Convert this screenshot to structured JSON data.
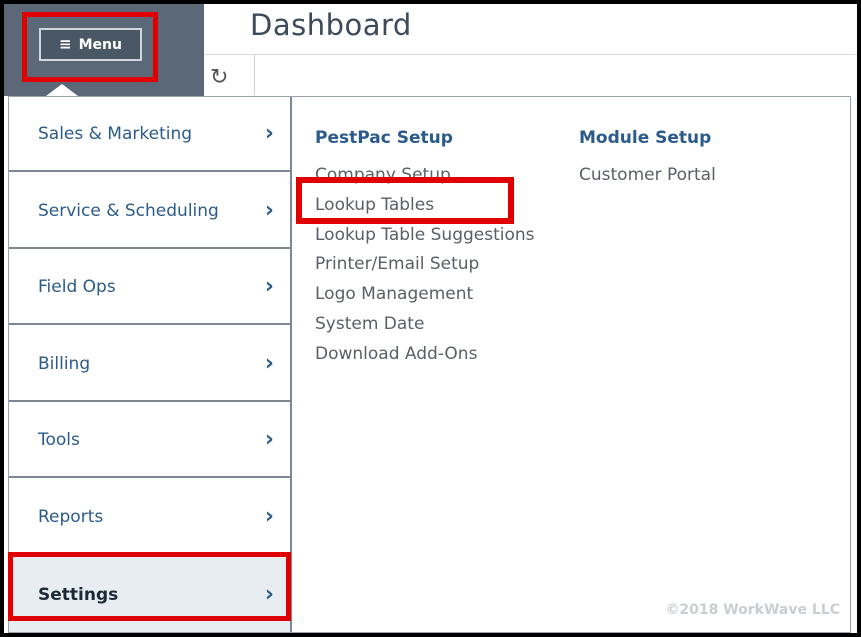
{
  "header": {
    "title": "Dashboard",
    "menu_label": "Menu"
  },
  "nav": {
    "items": [
      {
        "label": "Sales & Marketing"
      },
      {
        "label": "Service & Scheduling"
      },
      {
        "label": "Field Ops"
      },
      {
        "label": "Billing"
      },
      {
        "label": "Tools"
      },
      {
        "label": "Reports"
      },
      {
        "label": "Settings"
      }
    ],
    "chevron": "›"
  },
  "pestpac_setup": {
    "heading": "PestPac Setup",
    "links": [
      "Company Setup",
      "Lookup Tables",
      "Lookup Table Suggestions",
      "Printer/Email Setup",
      "Logo Management",
      "System Date",
      "Download Add-Ons"
    ]
  },
  "module_setup": {
    "heading": "Module Setup",
    "links": [
      "Customer Portal"
    ]
  },
  "footer": {
    "copyright": "©2018 WorkWave LLC"
  },
  "icons": {
    "menu": "hamburger-icon",
    "refresh": "refresh-icon",
    "chevron": "chevron-right-icon"
  },
  "colors": {
    "highlight": "#e00000",
    "link": "#2b5b8a",
    "nav_bg": "#5a6878"
  }
}
